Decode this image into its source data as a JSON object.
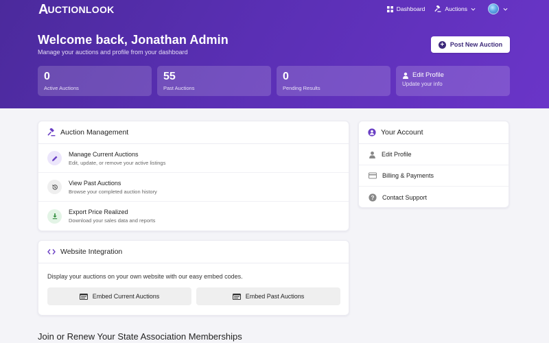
{
  "brand": {
    "logo_a": "A",
    "logo_rest": "UCTIONLOOK"
  },
  "nav": {
    "dashboard": "Dashboard",
    "auctions": "Auctions"
  },
  "hero": {
    "welcome": "Welcome back, Jonathan Admin",
    "subtitle": "Manage your auctions and profile from your dashboard",
    "post_button": "Post New Auction"
  },
  "stats": [
    {
      "value": "0",
      "label": "Active Auctions"
    },
    {
      "value": "55",
      "label": "Past Auctions"
    },
    {
      "value": "0",
      "label": "Pending Results"
    }
  ],
  "edit_profile_card": {
    "title": "Edit Profile",
    "subtitle": "Update your info"
  },
  "auction_management": {
    "title": "Auction Management",
    "items": [
      {
        "title": "Manage Current Auctions",
        "desc": "Edit, update, or remove your active listings"
      },
      {
        "title": "View Past Auctions",
        "desc": "Browse your completed auction history"
      },
      {
        "title": "Export Price Realized",
        "desc": "Download your sales data and reports"
      }
    ]
  },
  "account": {
    "title": "Your Account",
    "items": [
      "Edit Profile",
      "Billing & Payments",
      "Contact Support"
    ]
  },
  "integration": {
    "title": "Website Integration",
    "text": "Display your auctions on your own website with our easy embed codes.",
    "embed_current": "Embed Current Auctions",
    "embed_past": "Embed Past Auctions"
  },
  "memberships_title": "Join or Renew Your State Association Memberships",
  "colors": {
    "accent": "#5a2fb4",
    "purple_icon_bg": "#ece6fb",
    "green_icon_bg": "#e3f4e6"
  }
}
